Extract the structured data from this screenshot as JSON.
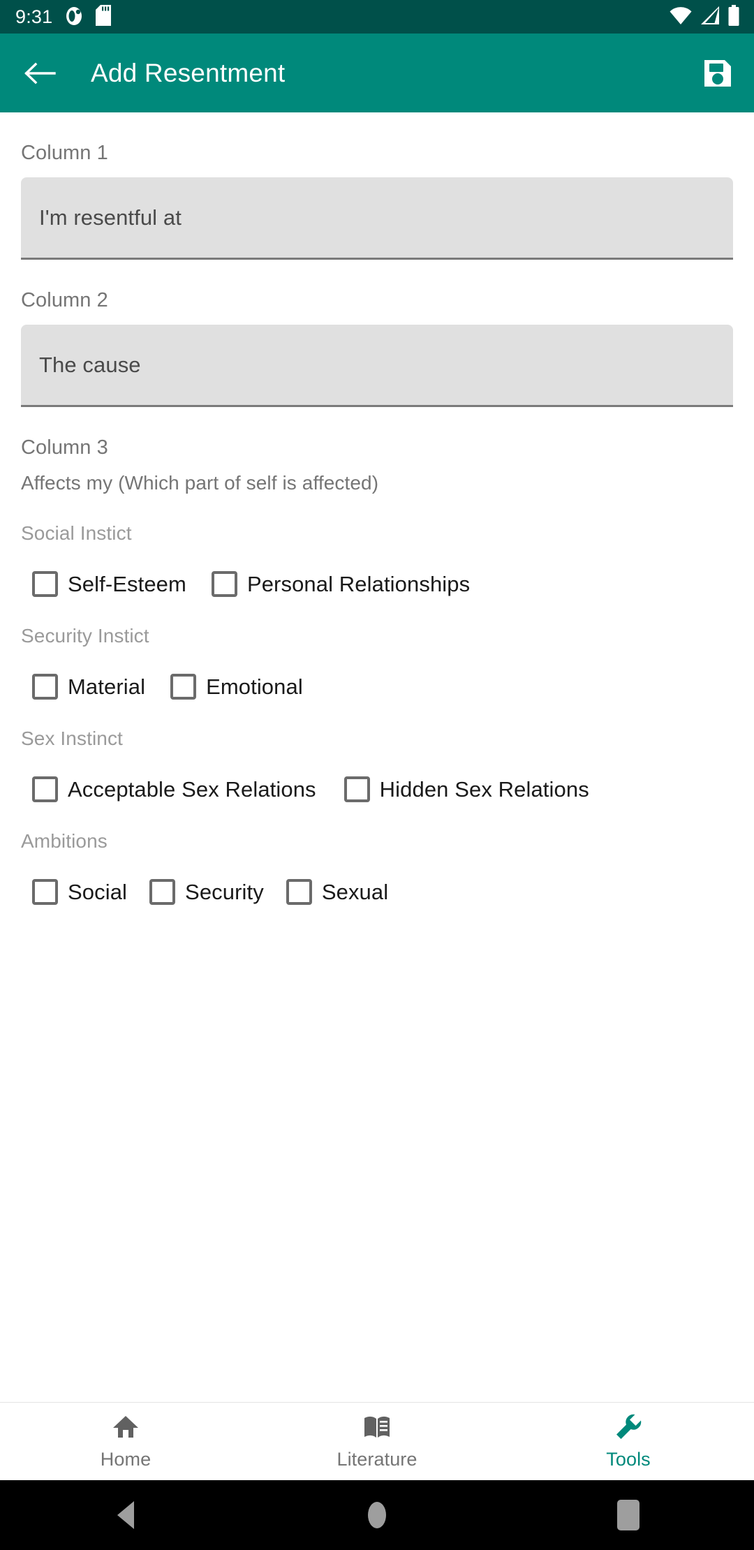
{
  "status_bar": {
    "time": "9:31",
    "left_icons": [
      {
        "name": "alarm-ring-icon",
        "label": "alarm"
      },
      {
        "name": "sd-card-icon",
        "label": "sd-card"
      }
    ],
    "right_icons": [
      {
        "name": "wifi-icon",
        "label": "wifi"
      },
      {
        "name": "cellular-no-sim-icon",
        "label": "no-sim"
      },
      {
        "name": "battery-full-icon",
        "label": "battery"
      }
    ],
    "background_color": "#00504A"
  },
  "app_bar": {
    "back_label": "Back",
    "title": "Add Resentment",
    "save_label": "Save",
    "background_color": "#00897B",
    "text_color": "#FFFFFF"
  },
  "form": {
    "column1": {
      "label": "Column 1",
      "placeholder": "I'm resentful at",
      "value": ""
    },
    "column2": {
      "label": "The cause",
      "section_label": "Column 2",
      "placeholder": "The cause",
      "value": ""
    },
    "column3": {
      "label": "Column 3",
      "helper": "Affects my (Which part of self is affected)"
    },
    "groups": [
      {
        "title": "Social Instict",
        "options": [
          {
            "label": "Self-Esteem",
            "checked": false
          },
          {
            "label": "Personal Relationships",
            "checked": false
          }
        ]
      },
      {
        "title": "Security Instict",
        "options": [
          {
            "label": "Material",
            "checked": false
          },
          {
            "label": "Emotional",
            "checked": false
          }
        ]
      },
      {
        "title": "Sex Instinct",
        "options": [
          {
            "label": "Acceptable Sex Relations",
            "checked": false
          },
          {
            "label": "Hidden Sex Relations",
            "checked": false
          }
        ]
      },
      {
        "title": "Ambitions",
        "options": [
          {
            "label": "Social",
            "checked": false
          },
          {
            "label": "Security",
            "checked": false
          },
          {
            "label": "Sexual",
            "checked": false
          }
        ]
      }
    ]
  },
  "bottom_nav": {
    "active_color": "#00897B",
    "inactive_color": "#757575",
    "items": [
      {
        "label": "Home",
        "icon": "home-icon",
        "active": false
      },
      {
        "label": "Literature",
        "icon": "book-icon",
        "active": false
      },
      {
        "label": "Tools",
        "icon": "wrench-icon",
        "active": true
      }
    ]
  },
  "android_nav": {
    "back": "Back",
    "home": "Home",
    "recents": "Recents"
  }
}
